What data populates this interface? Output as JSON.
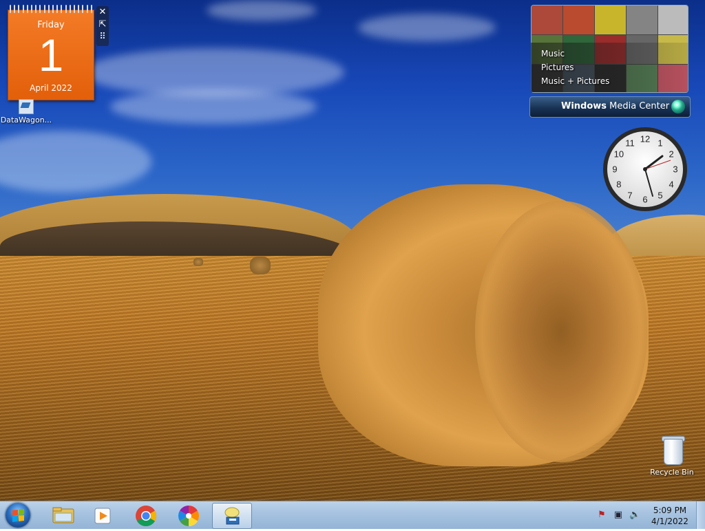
{
  "calendar": {
    "weekday": "Friday",
    "day": "1",
    "month_year": "April 2022"
  },
  "desktop_icons": {
    "datawagon": "DataWagon...",
    "recycle_bin": "Recycle Bin"
  },
  "media_center": {
    "menu": [
      "Music",
      "Pictures",
      "Music + Pictures"
    ],
    "bar_bold": "Windows",
    "bar_rest": " Media Center"
  },
  "clock_gadget": {
    "numbers": [
      "12",
      "1",
      "2",
      "3",
      "4",
      "5",
      "6",
      "7",
      "8",
      "9",
      "10",
      "11"
    ]
  },
  "taskbar": {
    "pinned": [
      "windows-explorer-icon",
      "media-player-icon",
      "chrome-icon",
      "photos-icon",
      "datawagon-icon"
    ],
    "time": "5:09 PM",
    "date": "4/1/2022"
  },
  "colors": {
    "calendar_accent": "#e8660f",
    "taskbar": "#a6c2e0"
  }
}
